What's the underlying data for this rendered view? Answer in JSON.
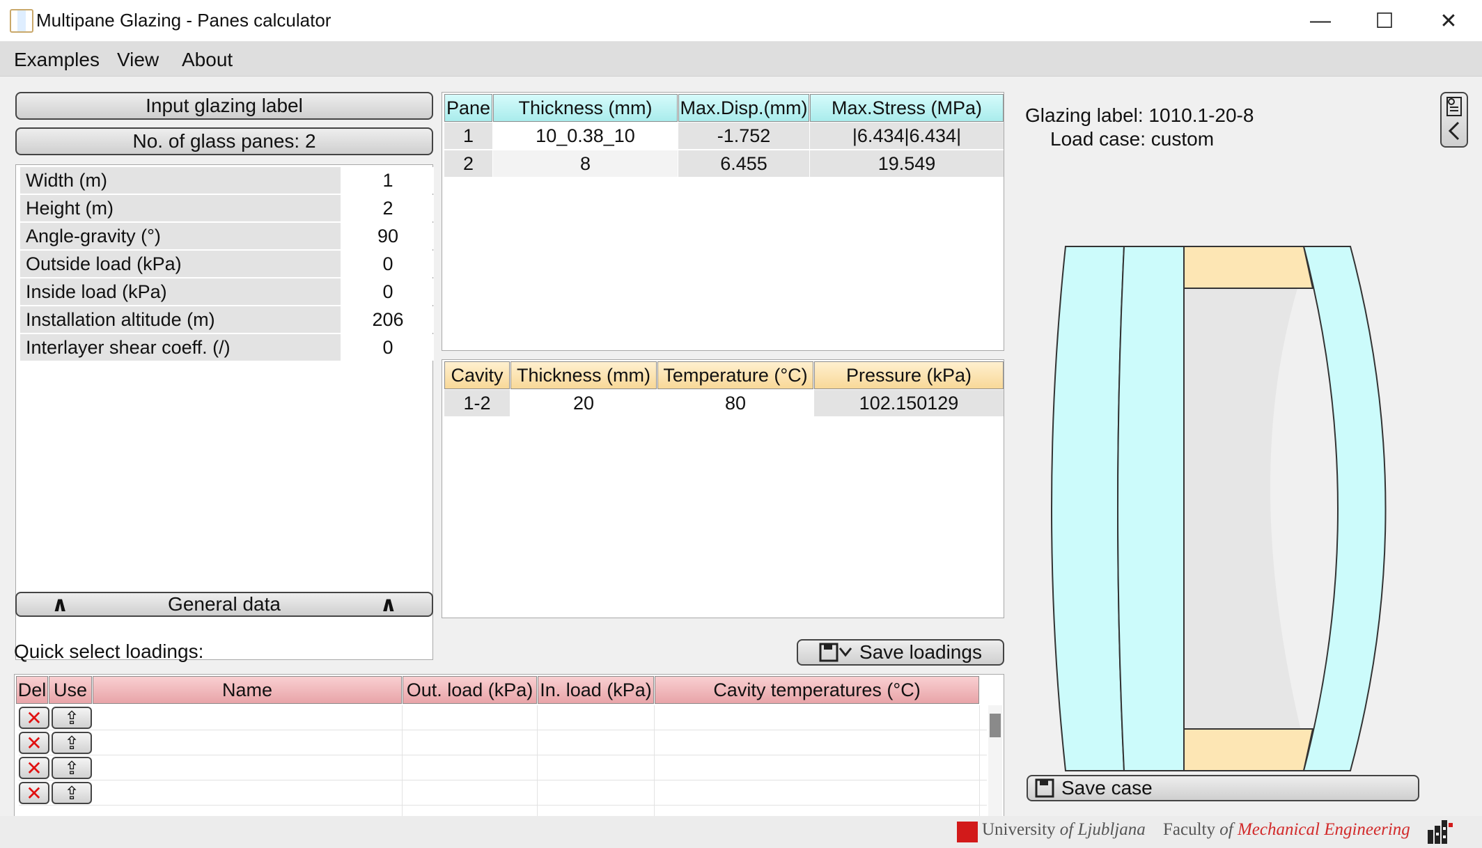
{
  "window": {
    "title": "Multipane Glazing - Panes calculator",
    "minimize_glyph": "—",
    "maximize_glyph": "☐",
    "close_glyph": "✕"
  },
  "menu": {
    "items": [
      "Examples",
      "View",
      "About"
    ]
  },
  "left": {
    "input_label_button": "Input glazing label",
    "panes_button": "No. of glass panes: 2",
    "properties": [
      {
        "name": "Width (m)",
        "value": "1"
      },
      {
        "name": "Height (m)",
        "value": "2"
      },
      {
        "name": "Angle-gravity (°)",
        "value": "90"
      },
      {
        "name": "Outside load (kPa)",
        "value": "0"
      },
      {
        "name": "Inside load (kPa)",
        "value": "0"
      },
      {
        "name": "Installation altitude (m)",
        "value": "206"
      },
      {
        "name": "Interlayer shear coeff. (/)",
        "value": "0"
      }
    ],
    "general_data_button": "General data",
    "chevron_glyph": "∧"
  },
  "panes_table": {
    "headers": [
      "Pane",
      "Thickness (mm)",
      "Max.Disp.(mm)",
      "Max.Stress (MPa)"
    ],
    "rows": [
      [
        "1",
        "10_0.38_10",
        "-1.752",
        "|6.434|6.434|"
      ],
      [
        "2",
        "8",
        "6.455",
        "19.549"
      ]
    ]
  },
  "cavity_table": {
    "headers": [
      "Cavity",
      "Thickness (mm)",
      "Temperature (°C)",
      "Pressure (kPa)"
    ],
    "rows": [
      [
        "1-2",
        "20",
        "80",
        "102.150129"
      ]
    ]
  },
  "quick": {
    "label": "Quick select loadings:",
    "save_loadings_button": "Save loadings",
    "headers": [
      "Del",
      "Use",
      "Name",
      "Out. load (kPa)",
      "In. load (kPa)",
      "Cavity temperatures (°C)"
    ],
    "row_count": 4,
    "delete_glyph": "✕",
    "use_glyph": "⇪"
  },
  "right": {
    "glazing_label_text": "Glazing label: 1010.1-20-8",
    "load_case_text": "Load case: custom",
    "save_case_button": "Save case",
    "pane_fill": "#ccfbfb",
    "spacer_fill": "#fde6b4",
    "cavity_fill": "#e6e6e6"
  },
  "footer": {
    "university_prefix": "University",
    "university_of": "of",
    "university_name": "Ljubljana",
    "faculty_prefix": "Faculty",
    "faculty_of": "of",
    "faculty_name": "Mechanical Engineering"
  }
}
